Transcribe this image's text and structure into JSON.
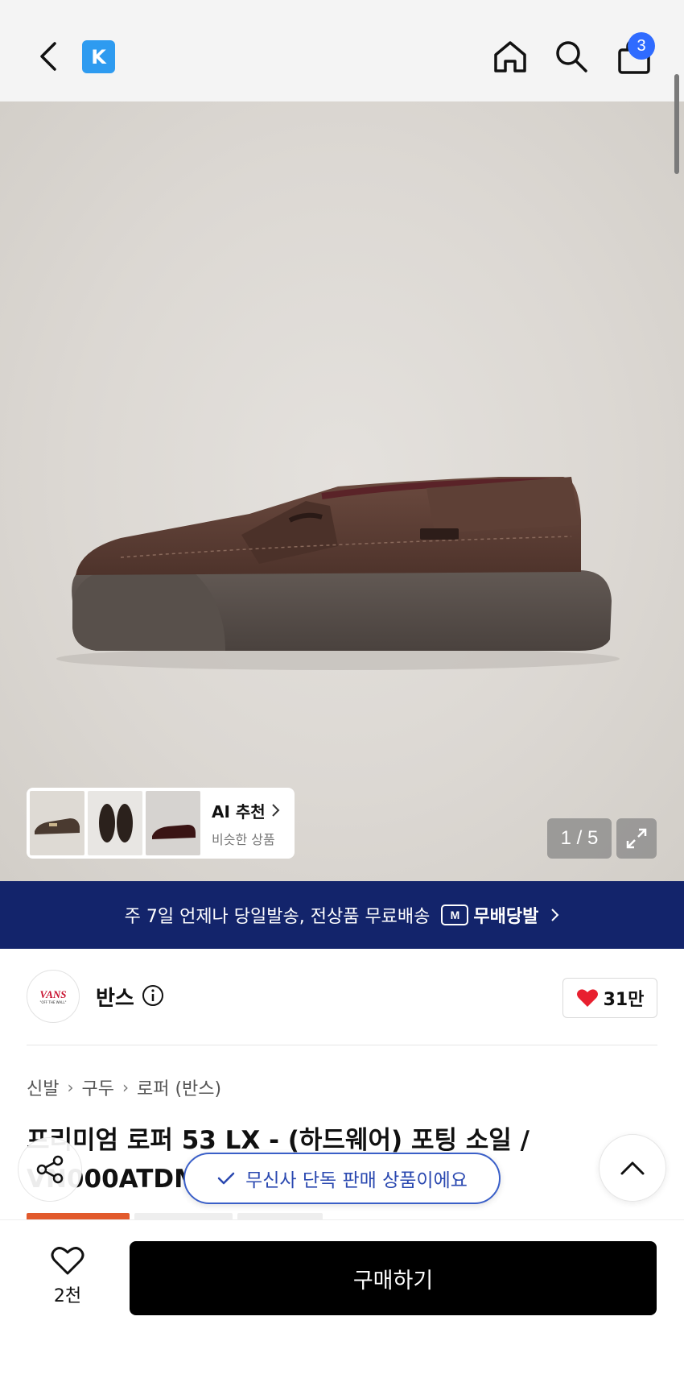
{
  "header": {
    "brand_logo_letter": "K",
    "cart_count": "3"
  },
  "hero": {
    "ai_title": "AI 추천",
    "ai_subtitle": "비슷한 상품",
    "pager": "1 / 5"
  },
  "banner": {
    "text": "주 7일 언제나 당일발송, 전상품 무료배송",
    "brand_mark": "M",
    "brand_label": "무배당발"
  },
  "brand": {
    "logo_text": "VANS",
    "logo_tagline": "\"OFF THE WALL\"",
    "name": "반스",
    "likes": "31만"
  },
  "breadcrumb": [
    "신발",
    "구두",
    "로퍼 (반스)"
  ],
  "product": {
    "title": "프리미엄 로퍼 53 LX - (하드웨어) 포팅 소일 / VN000ATDMV"
  },
  "exclusive_pill": "무신사 단독 판매 상품이에요",
  "bottom": {
    "wish_count": "2천",
    "buy_label": "구매하기"
  },
  "colors": {
    "banner": "#13246b",
    "cart_badge": "#2f6bff",
    "brand_logo": "#2e9bf0",
    "heart": "#e8202f"
  }
}
